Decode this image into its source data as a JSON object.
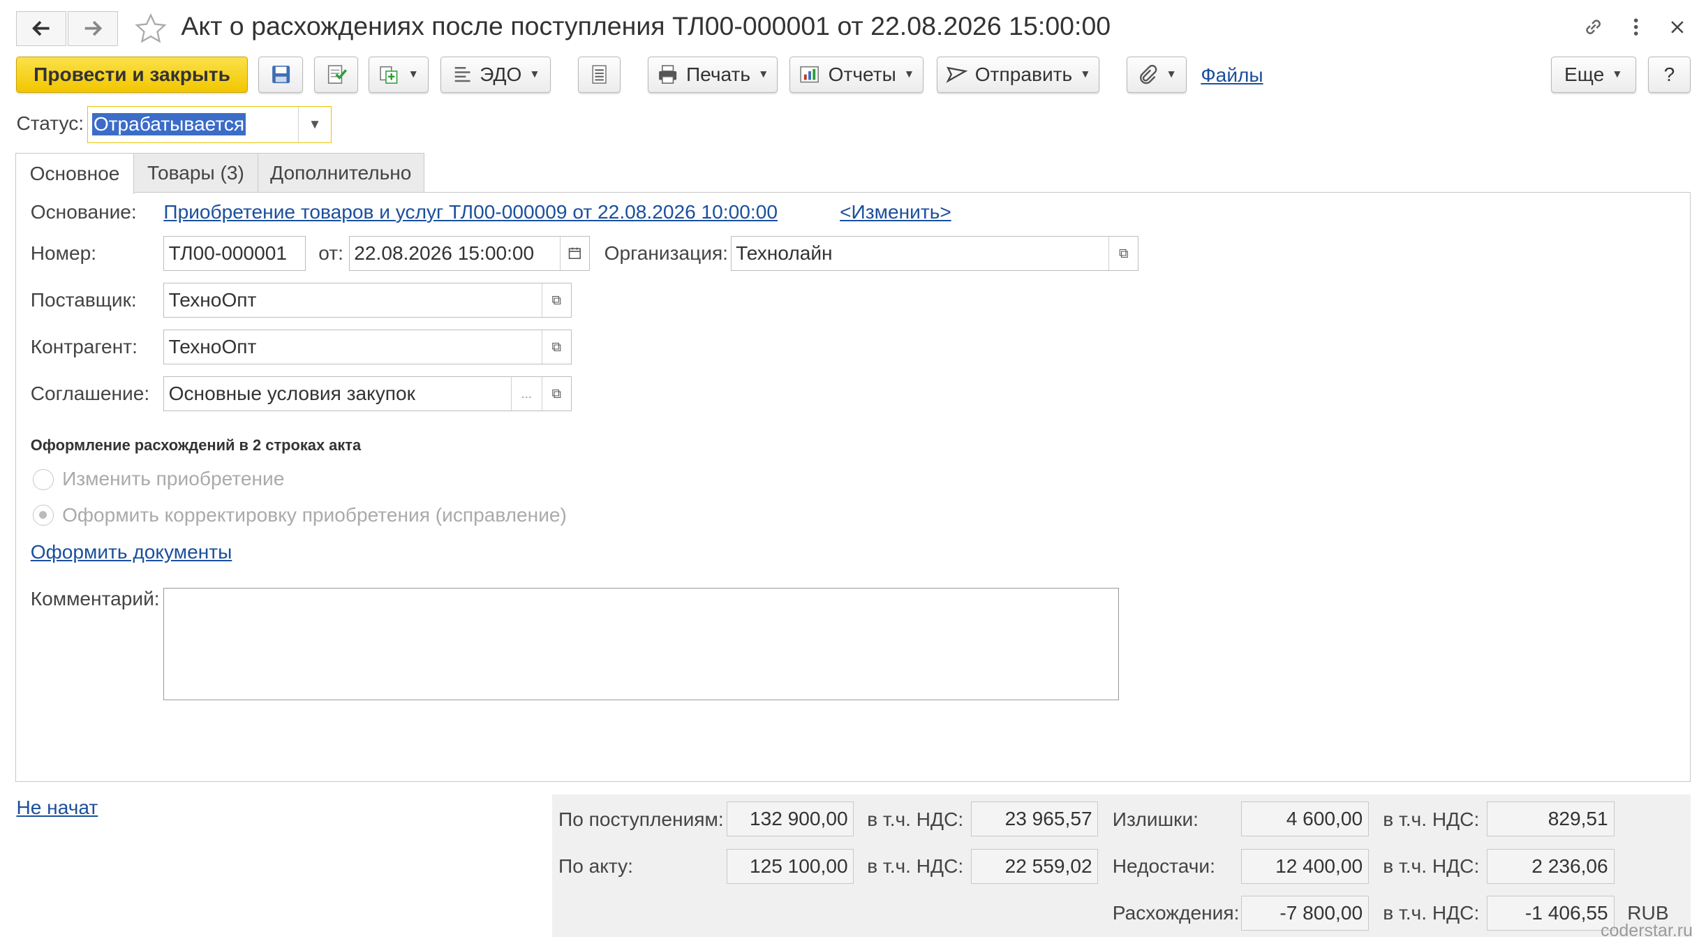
{
  "window": {
    "title": "Акт о расхождениях после поступления ТЛ00-000001 от 22.08.2026 15:00:00"
  },
  "toolbar": {
    "post_close": "Провести и закрыть",
    "edo": "ЭДО",
    "print": "Печать",
    "reports": "Отчеты",
    "send": "Отправить",
    "files": "Файлы",
    "more": "Еще",
    "help": "?"
  },
  "status": {
    "label": "Статус:",
    "value": "Отрабатывается"
  },
  "tabs": [
    {
      "label": "Основное"
    },
    {
      "label": "Товары (3)"
    },
    {
      "label": "Дополнительно"
    }
  ],
  "form": {
    "basis_label": "Основание:",
    "basis_link": "Приобретение товаров и услуг ТЛ00-000009 от 22.08.2026 10:00:00",
    "change_link": "<Изменить>",
    "number_label": "Номер:",
    "number_value": "ТЛ00-000001",
    "date_label": "от:",
    "date_value": "22.08.2026 15:00:00",
    "org_label": "Организация:",
    "org_value": "Технолайн",
    "supplier_label": "Поставщик:",
    "supplier_value": "ТехноОпт",
    "counterparty_label": "Контрагент:",
    "counterparty_value": "ТехноОпт",
    "agreement_label": "Соглашение:",
    "agreement_value": "Основные условия закупок",
    "agreement_dots": "...",
    "discrepancy_header": "Оформление расхождений в 2 строках акта",
    "radio_change": "Изменить приобретение",
    "radio_correction": "Оформить корректировку приобретения (исправление)",
    "create_docs_link": "Оформить документы",
    "comment_label": "Комментарий:",
    "comment_value": ""
  },
  "footer": {
    "not_started_link": "Не начат",
    "watermark": "coderstar.ru"
  },
  "totals": {
    "by_receipts_label": "По поступлениям:",
    "by_receipts_value": "132 900,00",
    "by_receipts_vat_label": "в т.ч. НДС:",
    "by_receipts_vat": "23 965,57",
    "by_act_label": "По акту:",
    "by_act_value": "125 100,00",
    "by_act_vat_label": "в т.ч. НДС:",
    "by_act_vat": "22 559,02",
    "surplus_label": "Излишки:",
    "surplus_value": "4 600,00",
    "surplus_vat_label": "в т.ч. НДС:",
    "surplus_vat": "829,51",
    "shortage_label": "Недостачи:",
    "shortage_value": "12 400,00",
    "shortage_vat_label": "в т.ч. НДС:",
    "shortage_vat": "2 236,06",
    "discrepancy_label": "Расхождения:",
    "discrepancy_value": "-7 800,00",
    "discrepancy_vat_label": "в т.ч. НДС:",
    "discrepancy_vat": "-1 406,55",
    "currency": "RUB"
  }
}
